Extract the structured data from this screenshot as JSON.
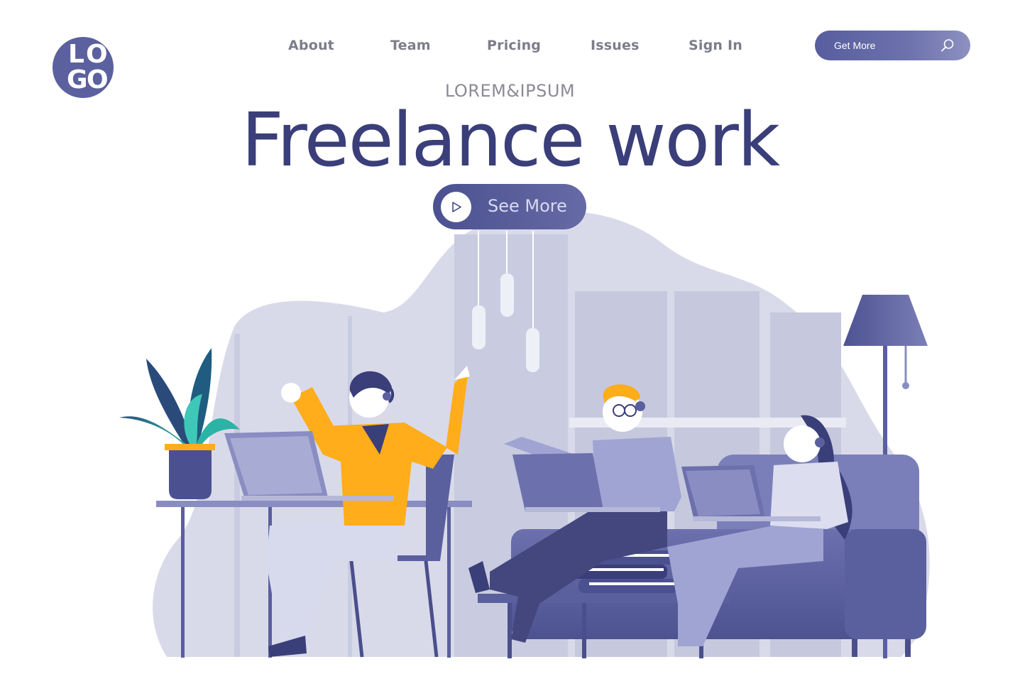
{
  "logo": {
    "letters": [
      "L",
      "O",
      "G",
      "O"
    ]
  },
  "nav": {
    "items": [
      {
        "label": "About"
      },
      {
        "label": "Team"
      },
      {
        "label": "Pricing"
      },
      {
        "label": "Issues"
      },
      {
        "label": "Sign In"
      }
    ]
  },
  "search": {
    "label": "Get More",
    "icon": "search-icon"
  },
  "hero": {
    "subtitle": "LOREM&IPSUM",
    "title": "Freelance work",
    "cta_label": "See More",
    "cta_icon": "play-icon"
  },
  "colors": {
    "primary": "#3a3e79",
    "accent": "#5b609f",
    "muted": "#8a8b96",
    "blob": "#dcdde9",
    "orange": "#ffad1a",
    "teal": "#2fb6a8"
  }
}
